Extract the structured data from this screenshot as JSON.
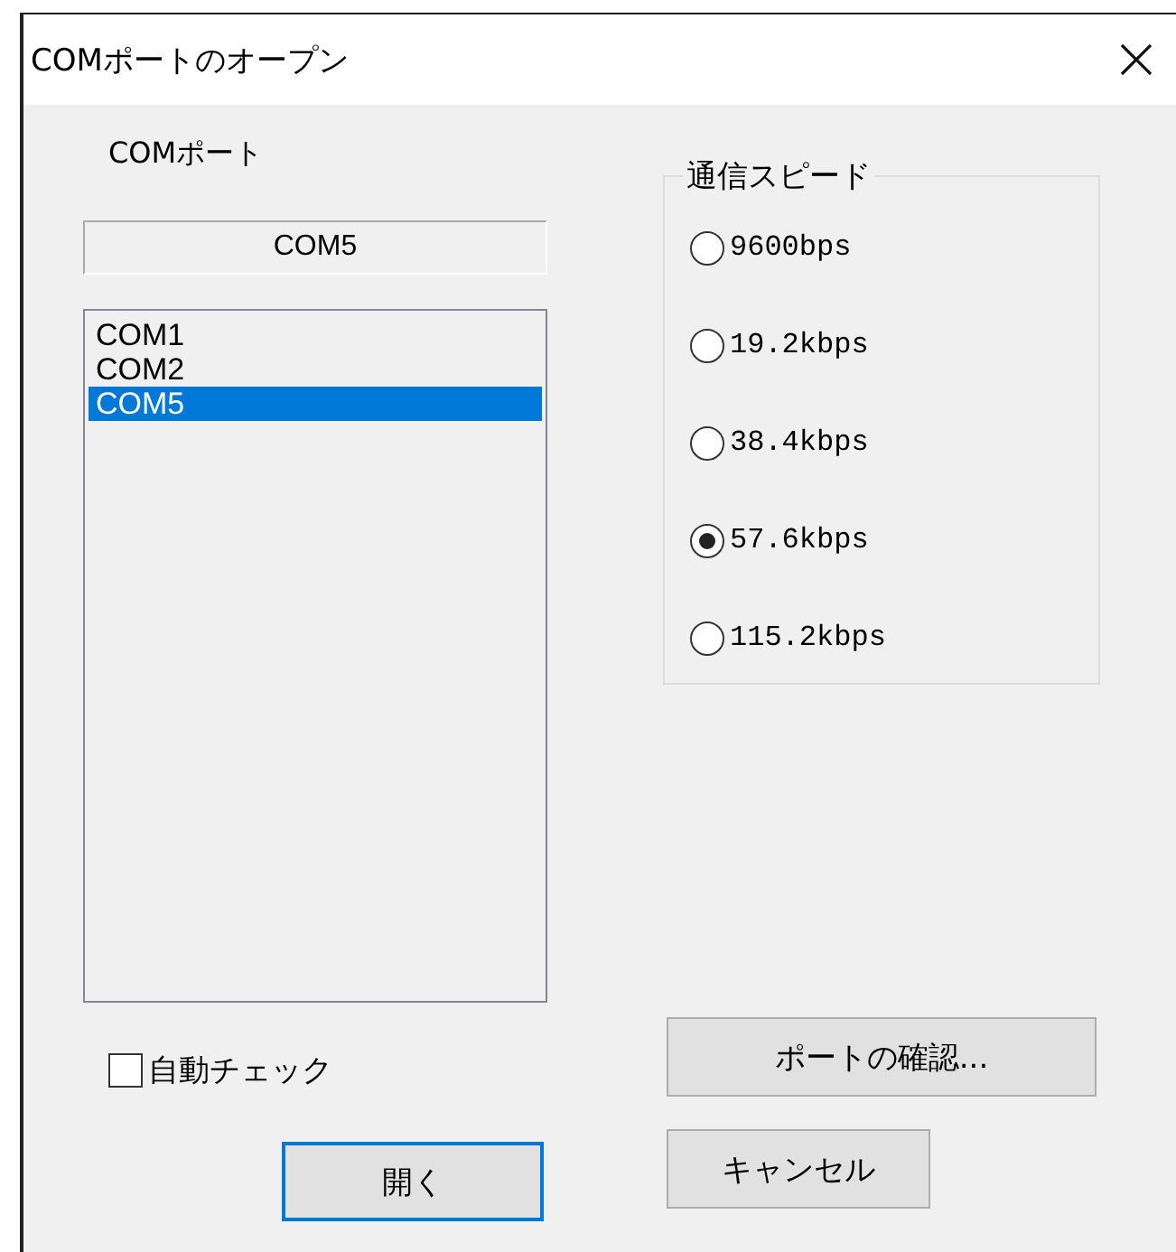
{
  "window": {
    "title": "COMポートのオープン"
  },
  "port_label": "COMポート",
  "port_display": {
    "value": "COM5"
  },
  "port_list": [
    {
      "label": "COM1",
      "selected": false
    },
    {
      "label": "COM2",
      "selected": false
    },
    {
      "label": "COM5",
      "selected": true
    }
  ],
  "speed_group": {
    "title": "通信スピード",
    "options": [
      {
        "label": "9600bps",
        "selected": false
      },
      {
        "label": "19.2kbps",
        "selected": false
      },
      {
        "label": "38.4kbps",
        "selected": false
      },
      {
        "label": "57.6kbps",
        "selected": true
      },
      {
        "label": "115.2kbps",
        "selected": false
      }
    ]
  },
  "auto_check": {
    "label": "自動チェック",
    "checked": false
  },
  "check_button": {
    "label": "ポートの確認..."
  },
  "buttons": [
    {
      "label": "開く",
      "default": true
    },
    {
      "label": "キャンセル",
      "default": false
    }
  ]
}
